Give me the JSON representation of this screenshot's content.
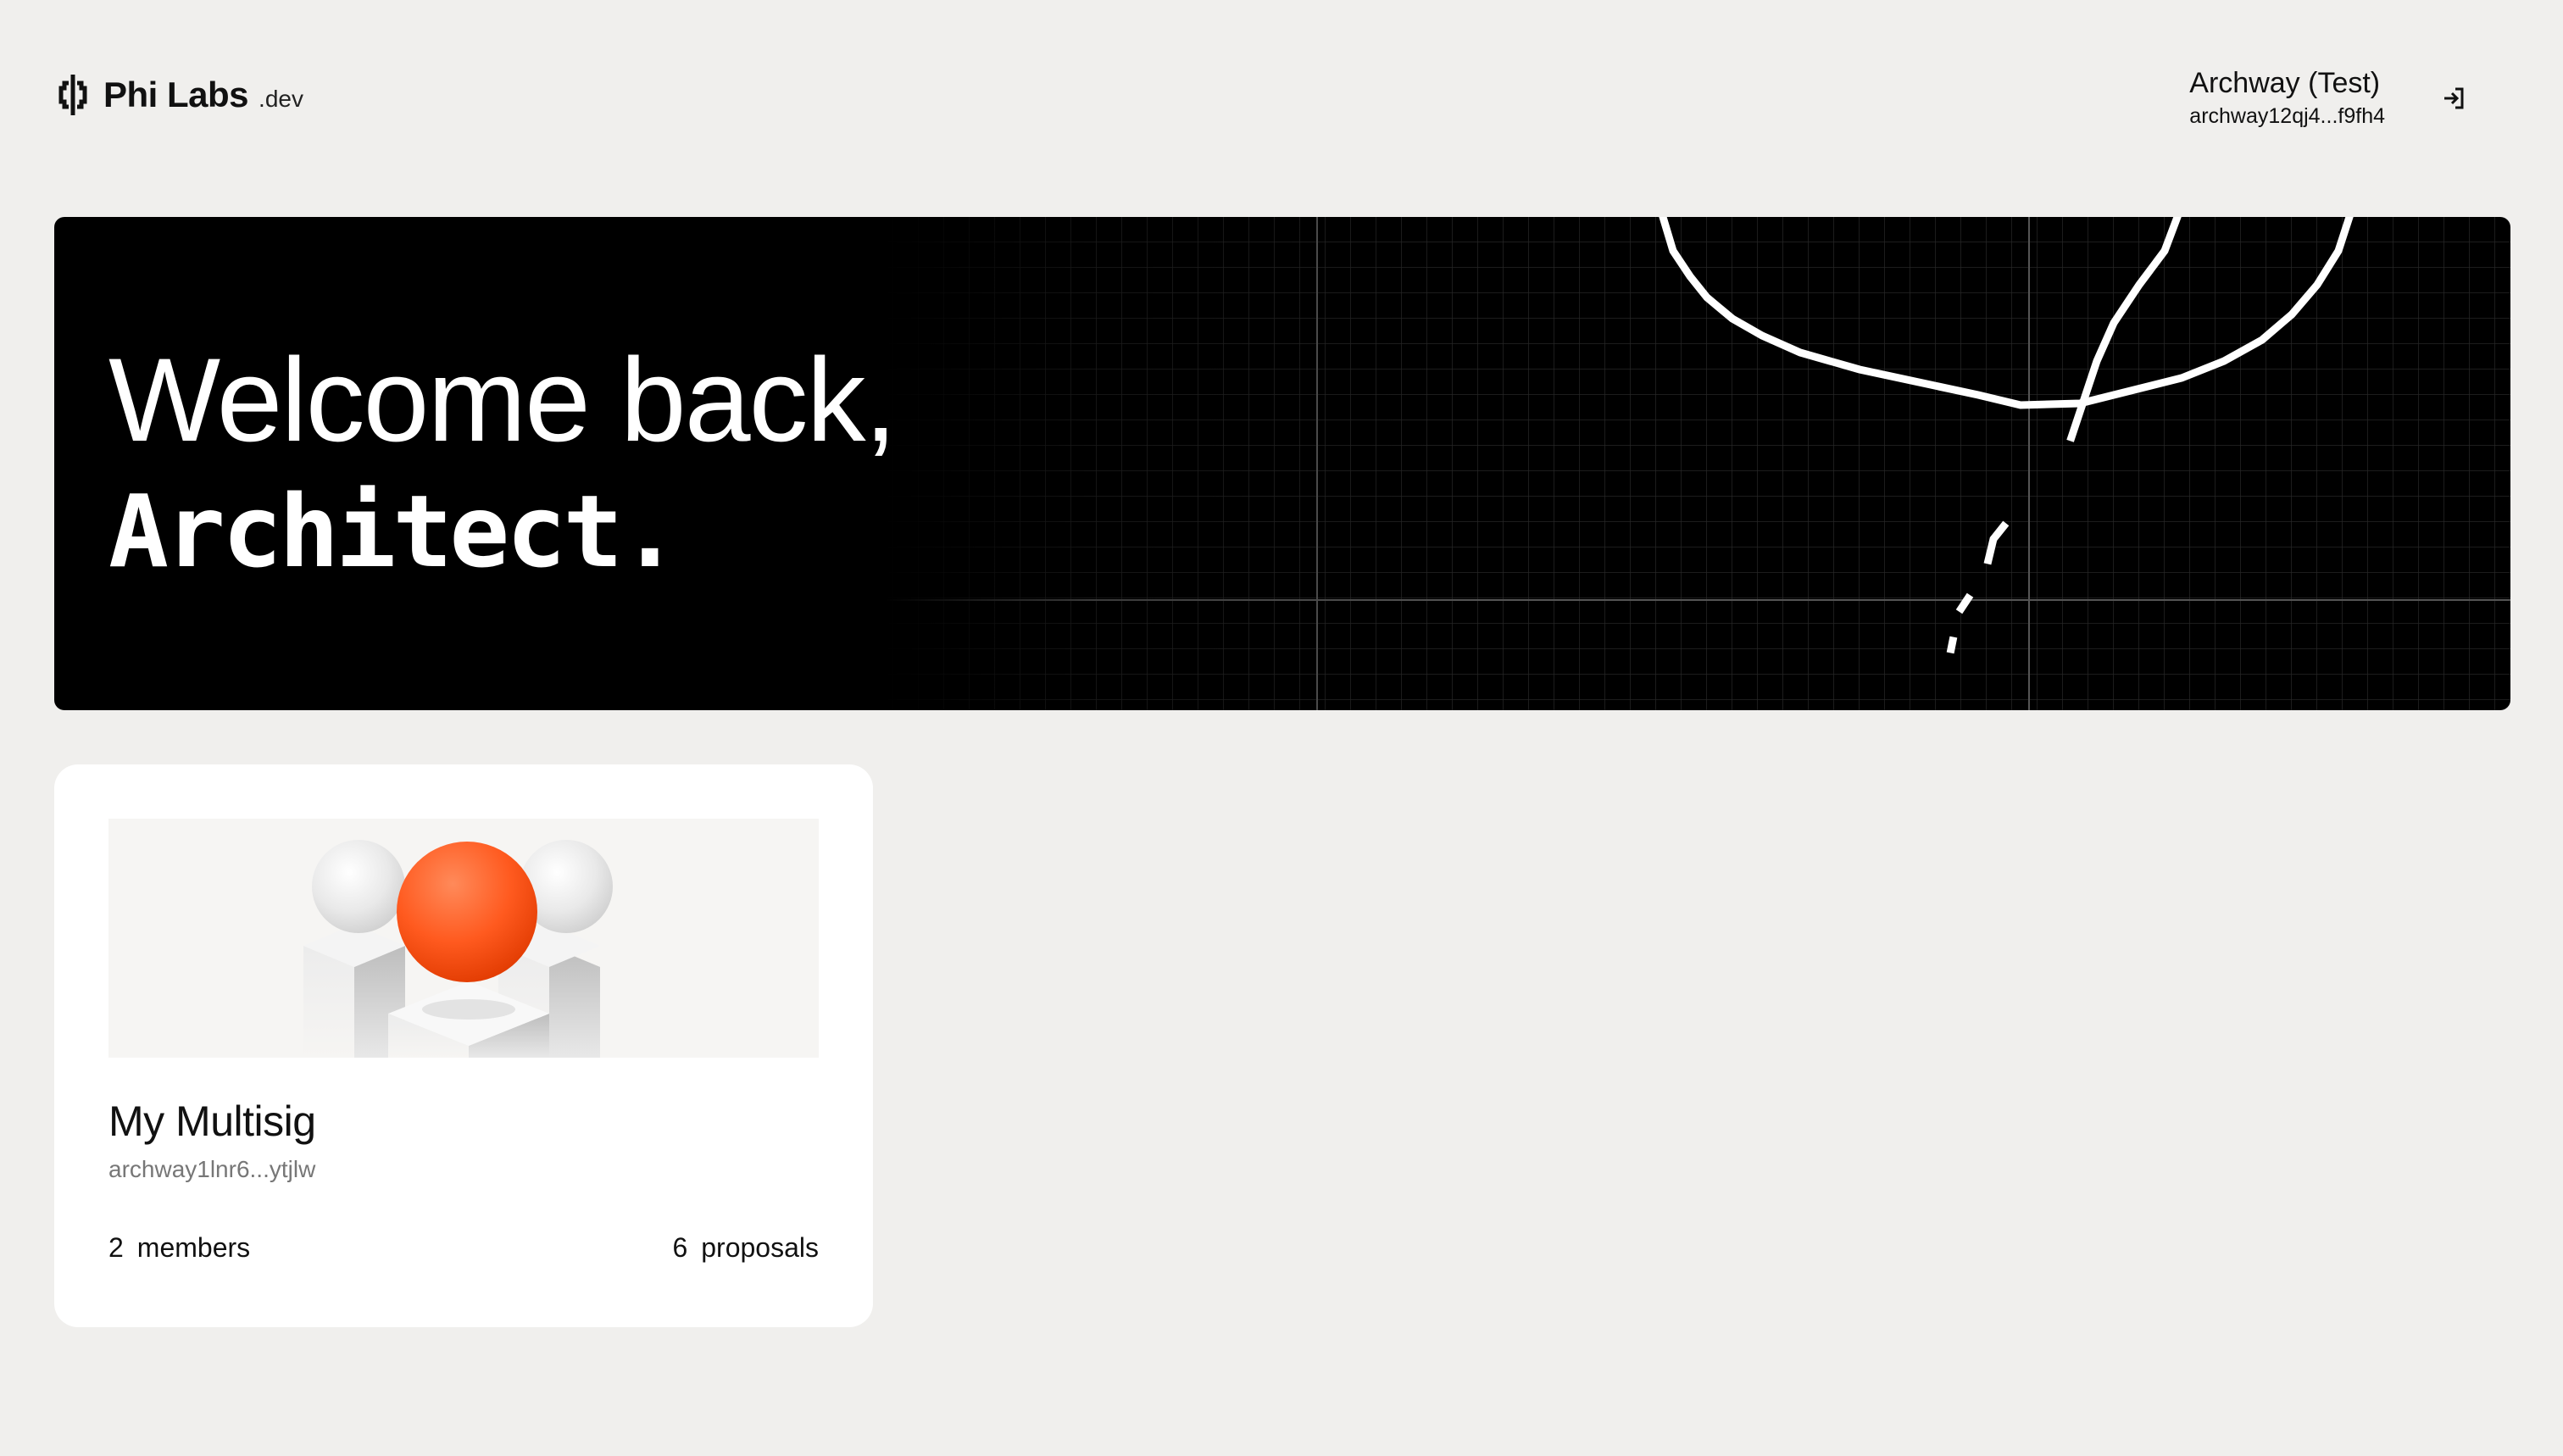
{
  "header": {
    "logo_name": "Phi Labs",
    "logo_suffix": ".dev",
    "account": {
      "network": "Archway (Test)",
      "address": "archway12qj4...f9fh4"
    },
    "logout_icon": "sign-in-arrow-icon"
  },
  "hero": {
    "greeting": "Welcome back,",
    "name": "Architect."
  },
  "multisigs": [
    {
      "title": "My Multisig",
      "address": "archway1lnr6...ytjlw",
      "members_count": "2",
      "members_label": "members",
      "proposals_count": "6",
      "proposals_label": "proposals"
    }
  ],
  "colors": {
    "background": "#f0efed",
    "hero_background": "#000000",
    "accent_orange": "#ff5a1f",
    "card_background": "#ffffff"
  }
}
